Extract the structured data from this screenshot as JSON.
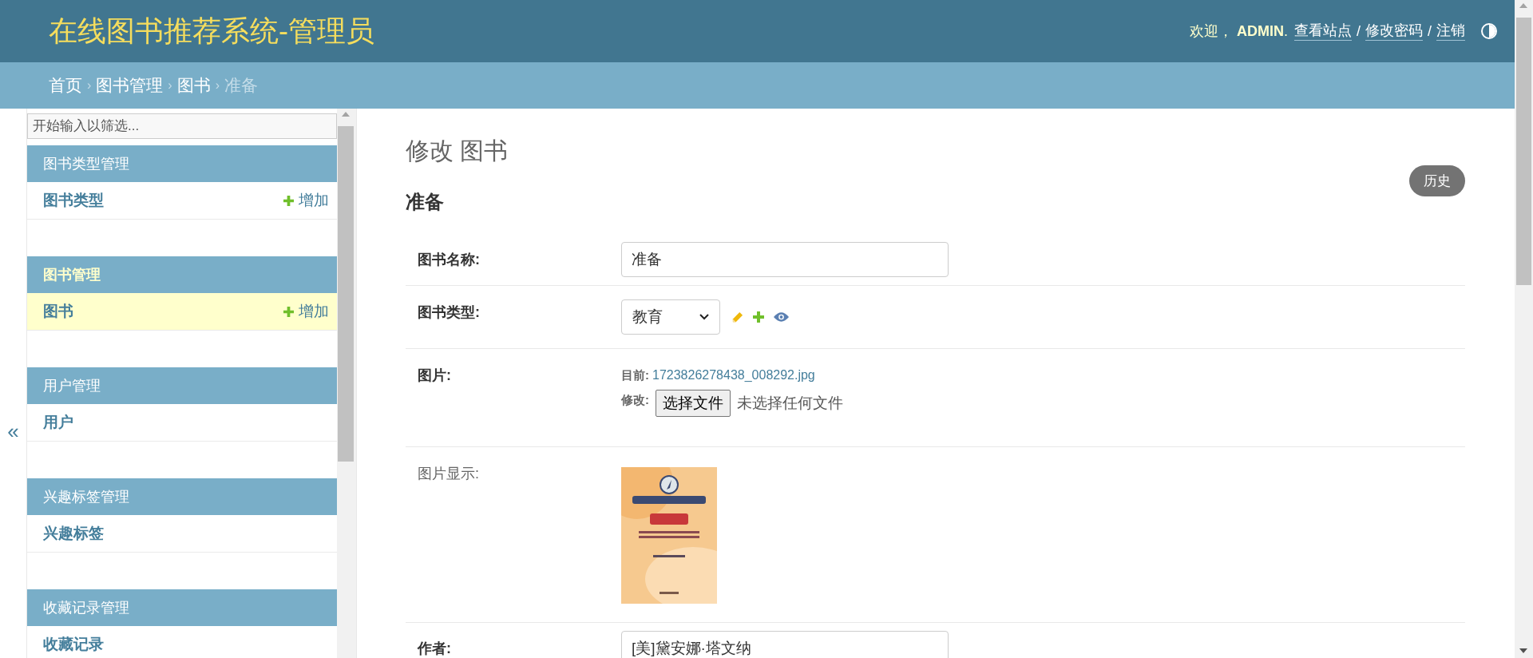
{
  "header": {
    "title": "在线图书推荐系统-管理员",
    "welcome": "欢迎， **ADMIN**.",
    "tools": [
      {
        "kind": "link",
        "text": "查看站点"
      },
      {
        "kind": "sep",
        "text": "/"
      },
      {
        "kind": "link",
        "text": "修改密码"
      },
      {
        "kind": "sep",
        "text": "/"
      },
      {
        "kind": "link",
        "text": "注销"
      }
    ]
  },
  "breadcrumbs": [
    {
      "kind": "link",
      "text": "首页"
    },
    {
      "kind": "sep",
      "text": "›"
    },
    {
      "kind": "link",
      "text": "图书管理"
    },
    {
      "kind": "sep",
      "text": "›"
    },
    {
      "kind": "link",
      "text": "图书"
    },
    {
      "kind": "sep",
      "text": "›"
    },
    {
      "kind": "current",
      "text": "准备"
    }
  ],
  "sidebar": {
    "toggle": "«",
    "filter": {
      "placeholder": "开始输入以筛选..."
    },
    "sections": [
      {
        "title": "图书类型管理",
        "selected": false,
        "items": [
          {
            "label": "图书类型",
            "add": "增加",
            "selected": false
          }
        ]
      },
      {
        "title": "图书管理",
        "selected": true,
        "items": [
          {
            "label": "图书",
            "add": "增加",
            "selected": true
          }
        ]
      },
      {
        "title": "用户管理",
        "selected": false,
        "items": [
          {
            "label": "用户",
            "selected": false
          }
        ]
      },
      {
        "title": "兴趣标签管理",
        "selected": false,
        "items": [
          {
            "label": "兴趣标签",
            "selected": false
          }
        ]
      },
      {
        "title": "收藏记录管理",
        "selected": false,
        "items": [
          {
            "label": "收藏记录",
            "selected": false
          }
        ]
      }
    ]
  },
  "main": {
    "title": "修改 图书",
    "object_name": "准备",
    "history_button": "历史",
    "fields": [
      {
        "kind": "text",
        "label": "图书名称:",
        "required": true,
        "value": "准备"
      },
      {
        "kind": "select",
        "label": "图书类型:",
        "required": true,
        "value": "教育"
      },
      {
        "kind": "file",
        "label": "图片:",
        "required": true,
        "current_label": "目前:",
        "current_file": "1723826278438_008292.jpg",
        "change_label": "修改:",
        "button": "选择文件",
        "no_file": "未选择任何文件"
      },
      {
        "label": "图片显示:",
        "required": false
      },
      {
        "kind": "text",
        "label": "作者:",
        "required": true,
        "value": "[美]黛安娜·塔文纳"
      }
    ]
  }
}
